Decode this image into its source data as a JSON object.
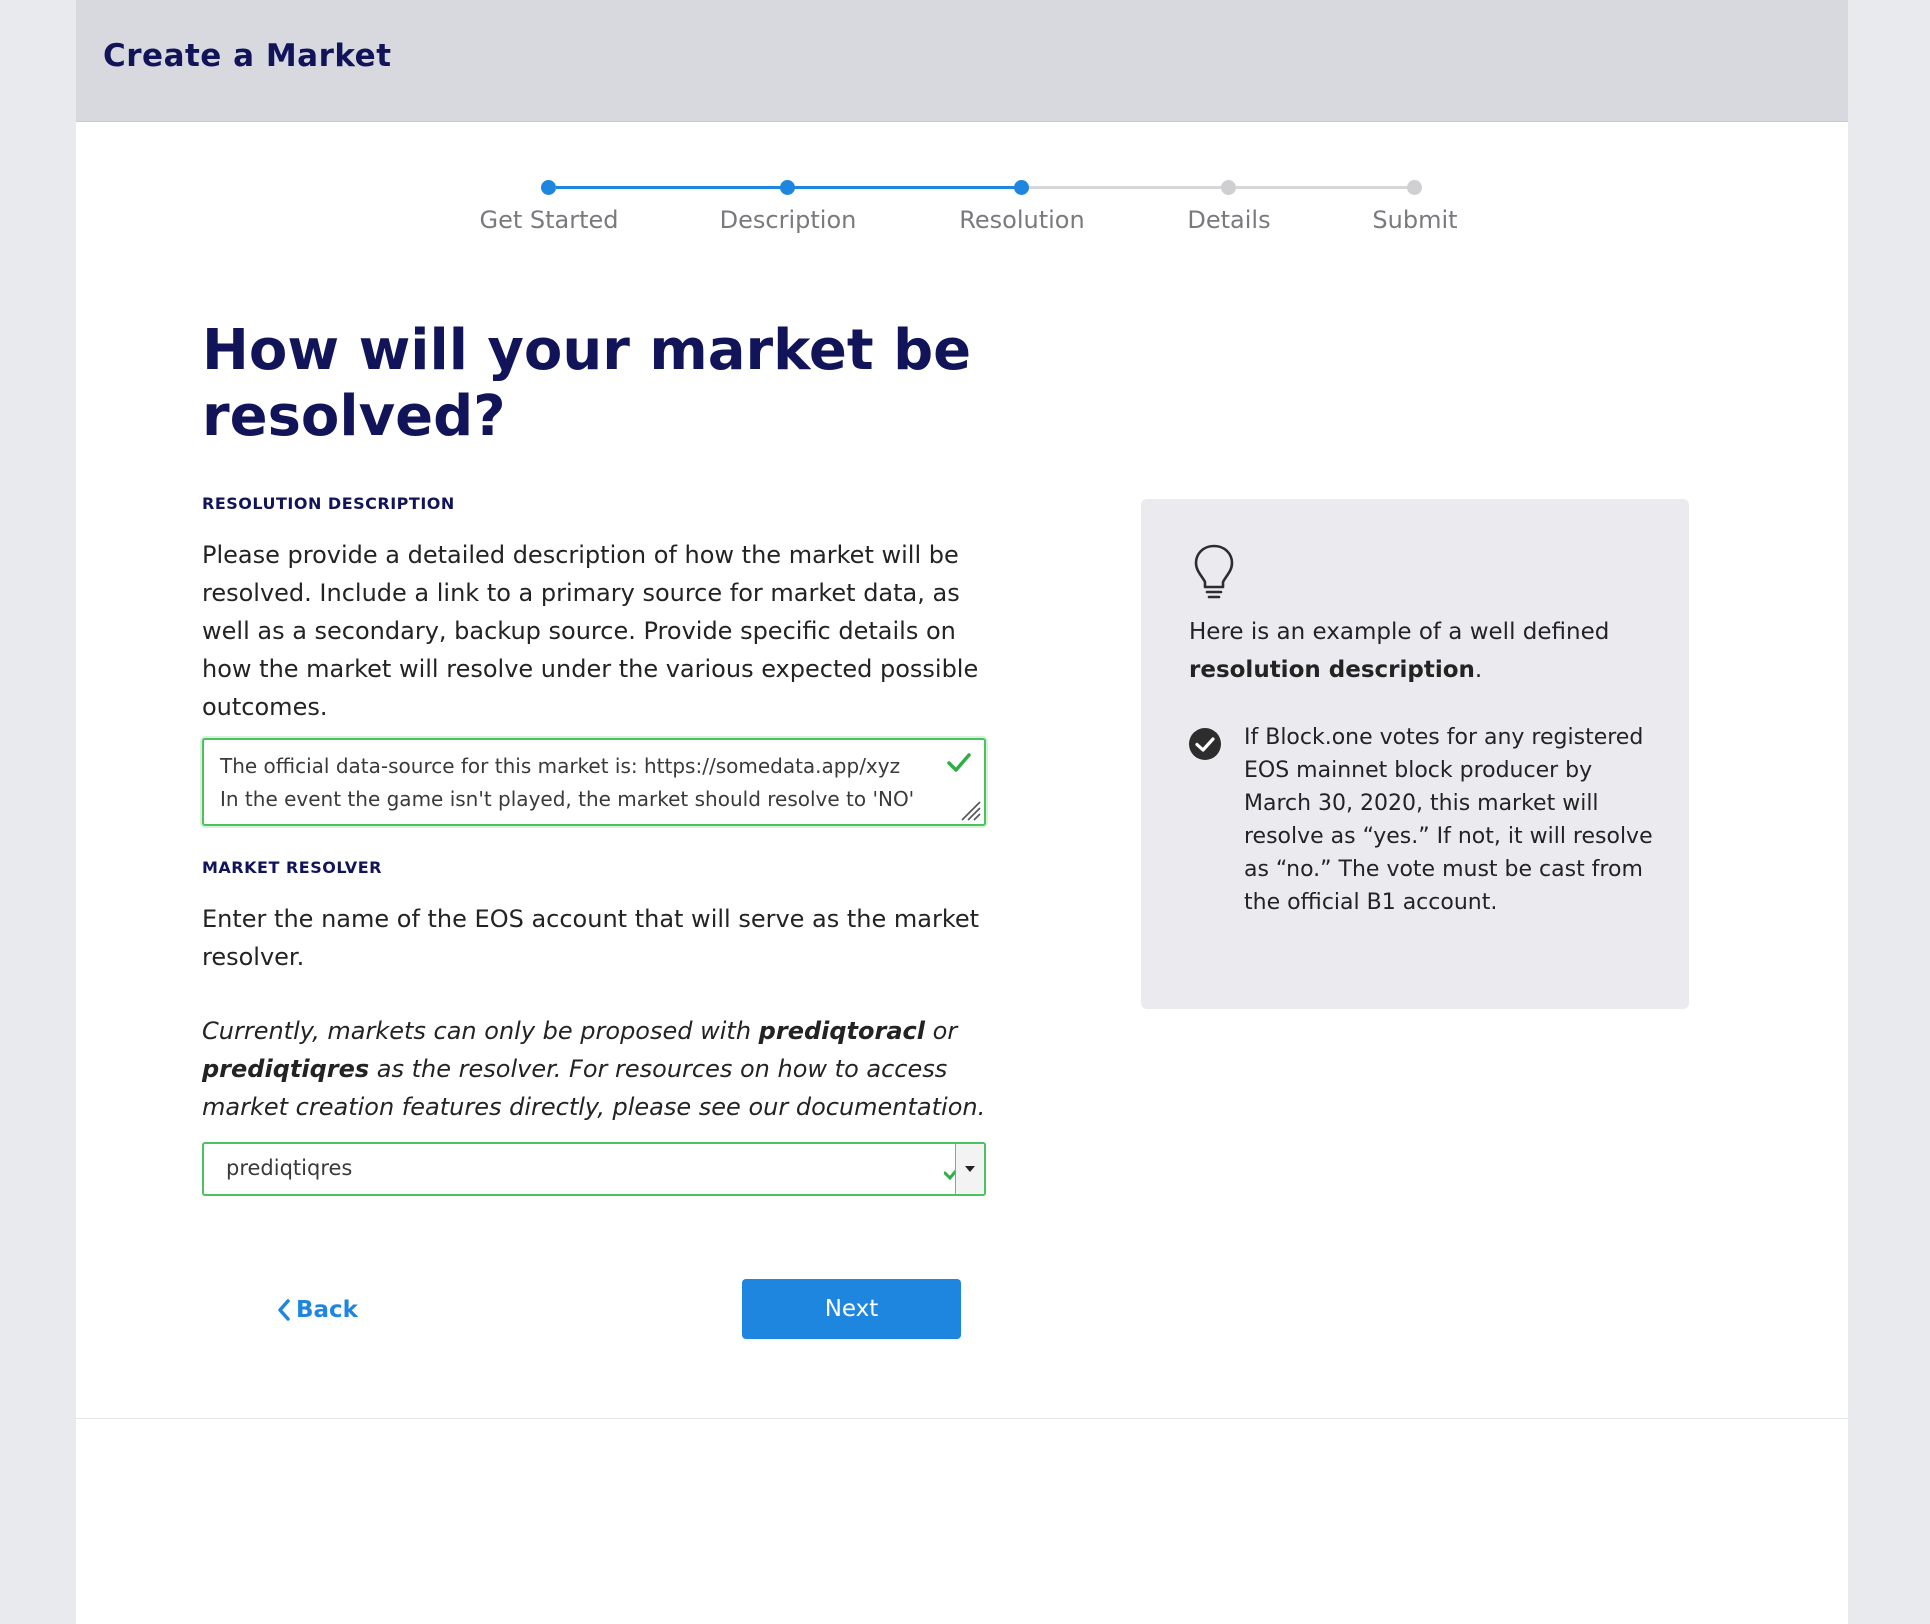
{
  "header": {
    "title": "Create a Market"
  },
  "stepper": {
    "steps": [
      {
        "label": "Get Started",
        "state": "complete"
      },
      {
        "label": "Description",
        "state": "complete"
      },
      {
        "label": "Resolution",
        "state": "current"
      },
      {
        "label": "Details",
        "state": "upcoming"
      },
      {
        "label": "Submit",
        "state": "upcoming"
      }
    ],
    "active_color": "#1f86e0",
    "inactive_color": "#cfcfd2"
  },
  "main": {
    "title": "How will your market be resolved?",
    "resolution_description": {
      "label": "RESOLUTION DESCRIPTION",
      "help": "Please provide a detailed description of how the market will be resolved. Include a link to a primary source for market data, as well as a secondary, backup source. Provide specific details on how the market will resolve under the various expected possible outcomes.",
      "value_line_1": "The official data-source for this market is: https://somedata.app/xyz",
      "value_line_2": "In the event the game isn't played, the market should resolve to 'NO'",
      "valid": true
    },
    "market_resolver": {
      "label": "MARKET RESOLVER",
      "help": "Enter the name of the EOS account that will serve as the market resolver.",
      "note_1": "Currently, markets can only be proposed with ",
      "note_bold_1": "prediqtoracl",
      "note_2": " or ",
      "note_bold_2": "prediqtiqres",
      "note_3": " as the resolver. For resources on how to access market creation features directly, please see our documentation.",
      "selected": "prediqtiqres",
      "valid": true
    },
    "back_label": "Back",
    "next_label": "Next"
  },
  "tip": {
    "icon": "lightbulb-icon",
    "intro": "Here is an example of a well defined ",
    "intro_bold": "resolution description",
    "intro_end": ".",
    "example": "If Block.one votes for any registered EOS mainnet block producer by March 30, 2020, this market will resolve as “yes.” If not, it will resolve as “no.” The vote must be cast from the official B1 account."
  },
  "colors": {
    "brand_navy": "#12145a",
    "accent_blue": "#1f86e0",
    "valid_green": "#4cc25e"
  }
}
